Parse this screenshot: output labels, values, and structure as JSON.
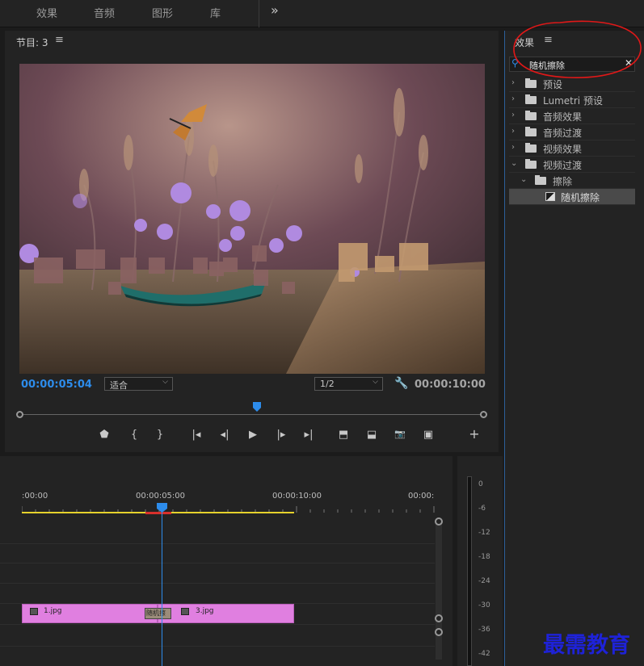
{
  "top_tabs": [
    "效果",
    "音频",
    "图形",
    "库"
  ],
  "top_more": "»",
  "monitor": {
    "title": "节目: 3",
    "menu": "≡",
    "timecode_current": "00:00:05:04",
    "fit_select": "适合",
    "quality_select": "1/2",
    "timecode_duration": "00:00:10:00",
    "controls": [
      {
        "name": "marker",
        "glyph": "⬟"
      },
      {
        "name": "mark-in",
        "glyph": "{"
      },
      {
        "name": "mark-out",
        "glyph": "}"
      },
      {
        "name": "go-to-in",
        "glyph": "|◂"
      },
      {
        "name": "step-back",
        "glyph": "◂|"
      },
      {
        "name": "play",
        "glyph": "▶"
      },
      {
        "name": "step-forward",
        "glyph": "|▸"
      },
      {
        "name": "go-to-out",
        "glyph": "▸|"
      },
      {
        "name": "lift",
        "glyph": "⬒"
      },
      {
        "name": "extract",
        "glyph": "⬓"
      },
      {
        "name": "export-frame",
        "glyph": "📷"
      },
      {
        "name": "comparison-view",
        "glyph": "▣"
      },
      {
        "name": "add",
        "glyph": "+"
      }
    ]
  },
  "effects_panel": {
    "title": "效果",
    "menu": "≡",
    "search_value": "随机擦除",
    "clear": "✕",
    "tree": [
      {
        "label": "预设",
        "level": 0,
        "expanded": false,
        "kind": "folder-star"
      },
      {
        "label": "Lumetri 预设",
        "level": 0,
        "expanded": false,
        "kind": "folder-star"
      },
      {
        "label": "音频效果",
        "level": 0,
        "expanded": false,
        "kind": "folder"
      },
      {
        "label": "音频过渡",
        "level": 0,
        "expanded": false,
        "kind": "folder"
      },
      {
        "label": "视频效果",
        "level": 0,
        "expanded": false,
        "kind": "folder"
      },
      {
        "label": "视频过渡",
        "level": 0,
        "expanded": true,
        "kind": "folder"
      },
      {
        "label": "擦除",
        "level": 1,
        "expanded": true,
        "kind": "folder"
      },
      {
        "label": "随机擦除",
        "level": 2,
        "expanded": false,
        "kind": "effect",
        "selected": true
      }
    ]
  },
  "timeline": {
    "ruler_labels": [
      ":00:00",
      "00:00:05:00",
      "00:00:10:00",
      "00:00:"
    ],
    "clips": [
      {
        "name": "1.jpg"
      },
      {
        "name": "3.jpg"
      }
    ],
    "transition_label": "随机擦"
  },
  "meter": {
    "labels": [
      "0",
      "-6",
      "-12",
      "-18",
      "-24",
      "-30",
      "-36",
      "-42"
    ]
  },
  "watermark": "最需教育",
  "colors": {
    "accent": "#2d8ceb",
    "clip": "#e07fe0",
    "work_area": "#e6d22c",
    "annotation": "#e01818"
  }
}
